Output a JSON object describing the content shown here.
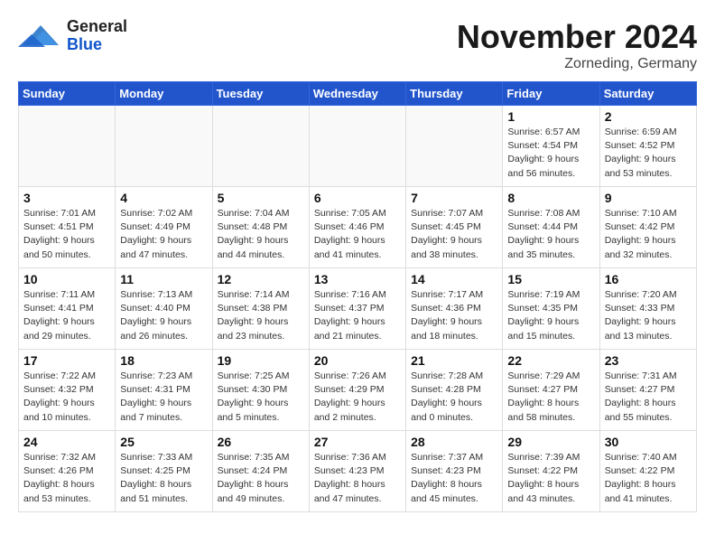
{
  "header": {
    "logo_general": "General",
    "logo_blue": "Blue",
    "month_title": "November 2024",
    "location": "Zorneding, Germany"
  },
  "weekdays": [
    "Sunday",
    "Monday",
    "Tuesday",
    "Wednesday",
    "Thursday",
    "Friday",
    "Saturday"
  ],
  "weeks": [
    [
      {
        "day": "",
        "info": ""
      },
      {
        "day": "",
        "info": ""
      },
      {
        "day": "",
        "info": ""
      },
      {
        "day": "",
        "info": ""
      },
      {
        "day": "",
        "info": ""
      },
      {
        "day": "1",
        "info": "Sunrise: 6:57 AM\nSunset: 4:54 PM\nDaylight: 9 hours and 56 minutes."
      },
      {
        "day": "2",
        "info": "Sunrise: 6:59 AM\nSunset: 4:52 PM\nDaylight: 9 hours and 53 minutes."
      }
    ],
    [
      {
        "day": "3",
        "info": "Sunrise: 7:01 AM\nSunset: 4:51 PM\nDaylight: 9 hours and 50 minutes."
      },
      {
        "day": "4",
        "info": "Sunrise: 7:02 AM\nSunset: 4:49 PM\nDaylight: 9 hours and 47 minutes."
      },
      {
        "day": "5",
        "info": "Sunrise: 7:04 AM\nSunset: 4:48 PM\nDaylight: 9 hours and 44 minutes."
      },
      {
        "day": "6",
        "info": "Sunrise: 7:05 AM\nSunset: 4:46 PM\nDaylight: 9 hours and 41 minutes."
      },
      {
        "day": "7",
        "info": "Sunrise: 7:07 AM\nSunset: 4:45 PM\nDaylight: 9 hours and 38 minutes."
      },
      {
        "day": "8",
        "info": "Sunrise: 7:08 AM\nSunset: 4:44 PM\nDaylight: 9 hours and 35 minutes."
      },
      {
        "day": "9",
        "info": "Sunrise: 7:10 AM\nSunset: 4:42 PM\nDaylight: 9 hours and 32 minutes."
      }
    ],
    [
      {
        "day": "10",
        "info": "Sunrise: 7:11 AM\nSunset: 4:41 PM\nDaylight: 9 hours and 29 minutes."
      },
      {
        "day": "11",
        "info": "Sunrise: 7:13 AM\nSunset: 4:40 PM\nDaylight: 9 hours and 26 minutes."
      },
      {
        "day": "12",
        "info": "Sunrise: 7:14 AM\nSunset: 4:38 PM\nDaylight: 9 hours and 23 minutes."
      },
      {
        "day": "13",
        "info": "Sunrise: 7:16 AM\nSunset: 4:37 PM\nDaylight: 9 hours and 21 minutes."
      },
      {
        "day": "14",
        "info": "Sunrise: 7:17 AM\nSunset: 4:36 PM\nDaylight: 9 hours and 18 minutes."
      },
      {
        "day": "15",
        "info": "Sunrise: 7:19 AM\nSunset: 4:35 PM\nDaylight: 9 hours and 15 minutes."
      },
      {
        "day": "16",
        "info": "Sunrise: 7:20 AM\nSunset: 4:33 PM\nDaylight: 9 hours and 13 minutes."
      }
    ],
    [
      {
        "day": "17",
        "info": "Sunrise: 7:22 AM\nSunset: 4:32 PM\nDaylight: 9 hours and 10 minutes."
      },
      {
        "day": "18",
        "info": "Sunrise: 7:23 AM\nSunset: 4:31 PM\nDaylight: 9 hours and 7 minutes."
      },
      {
        "day": "19",
        "info": "Sunrise: 7:25 AM\nSunset: 4:30 PM\nDaylight: 9 hours and 5 minutes."
      },
      {
        "day": "20",
        "info": "Sunrise: 7:26 AM\nSunset: 4:29 PM\nDaylight: 9 hours and 2 minutes."
      },
      {
        "day": "21",
        "info": "Sunrise: 7:28 AM\nSunset: 4:28 PM\nDaylight: 9 hours and 0 minutes."
      },
      {
        "day": "22",
        "info": "Sunrise: 7:29 AM\nSunset: 4:27 PM\nDaylight: 8 hours and 58 minutes."
      },
      {
        "day": "23",
        "info": "Sunrise: 7:31 AM\nSunset: 4:27 PM\nDaylight: 8 hours and 55 minutes."
      }
    ],
    [
      {
        "day": "24",
        "info": "Sunrise: 7:32 AM\nSunset: 4:26 PM\nDaylight: 8 hours and 53 minutes."
      },
      {
        "day": "25",
        "info": "Sunrise: 7:33 AM\nSunset: 4:25 PM\nDaylight: 8 hours and 51 minutes."
      },
      {
        "day": "26",
        "info": "Sunrise: 7:35 AM\nSunset: 4:24 PM\nDaylight: 8 hours and 49 minutes."
      },
      {
        "day": "27",
        "info": "Sunrise: 7:36 AM\nSunset: 4:23 PM\nDaylight: 8 hours and 47 minutes."
      },
      {
        "day": "28",
        "info": "Sunrise: 7:37 AM\nSunset: 4:23 PM\nDaylight: 8 hours and 45 minutes."
      },
      {
        "day": "29",
        "info": "Sunrise: 7:39 AM\nSunset: 4:22 PM\nDaylight: 8 hours and 43 minutes."
      },
      {
        "day": "30",
        "info": "Sunrise: 7:40 AM\nSunset: 4:22 PM\nDaylight: 8 hours and 41 minutes."
      }
    ]
  ]
}
